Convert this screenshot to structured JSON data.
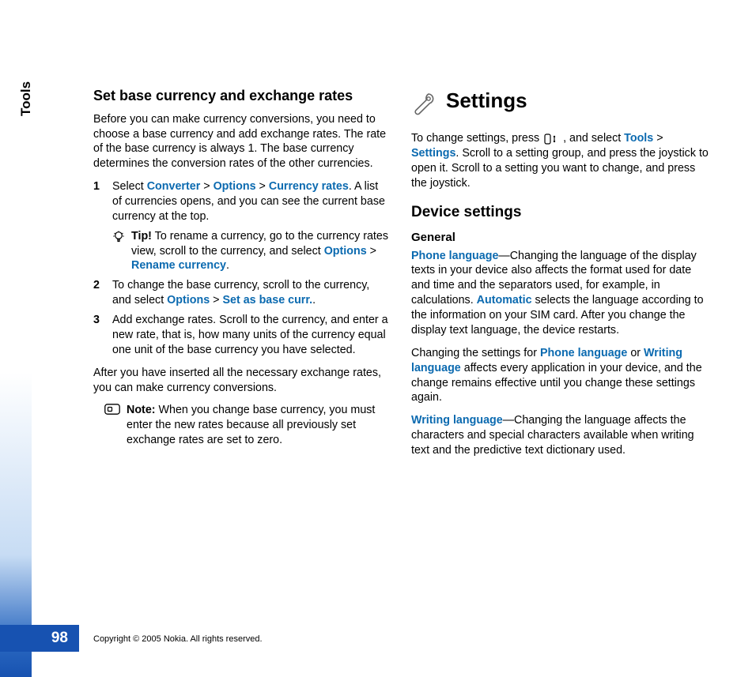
{
  "page_number": "98",
  "section_label": "Tools",
  "copyright": "Copyright © 2005 Nokia. All rights reserved.",
  "left": {
    "h1": "Set base currency and exchange rates",
    "p1": "Before you can make currency conversions, you need to choose a base currency and add exchange rates. The rate of the base currency is always 1. The base currency determines the conversion rates of the other currencies.",
    "li1_num": "1",
    "li1_a": "Select ",
    "li1_b": "Converter",
    "li1_c": " > ",
    "li1_d": "Options",
    "li1_e": " > ",
    "li1_f": "Currency rates",
    "li1_g": ". A list of currencies opens, and you can see the current base currency at the top.",
    "tip_label": "Tip!",
    "tip_a": " To rename a currency, go to the currency rates view, scroll to the currency, and select ",
    "tip_b": "Options",
    "tip_c": " > ",
    "tip_d": "Rename currency",
    "tip_e": ".",
    "li2_num": "2",
    "li2_a": "To change the base currency, scroll to the currency, and select ",
    "li2_b": "Options",
    "li2_c": " > ",
    "li2_d": "Set as base curr.",
    "li2_e": ".",
    "li3_num": "3",
    "li3_a": "Add exchange rates. Scroll to the currency, and enter a new rate, that is, how many units of the currency equal one unit of the base currency you have selected.",
    "p2": "After you have inserted all the necessary exchange rates, you can make currency conversions.",
    "note_label": "Note:",
    "note_a": " When you change base currency, you must enter the new rates because all previously set exchange rates are set to zero."
  },
  "right": {
    "h1": "Settings",
    "p1_a": "To change settings, press ",
    "p1_b": " , and select ",
    "p1_c": "Tools",
    "p1_d": " > ",
    "p1_e": "Settings",
    "p1_f": ". Scroll to a setting group, and press the joystick to open it. Scroll to a setting you want to change, and press the joystick.",
    "h2": "Device settings",
    "h3": "General",
    "p2_a": "Phone language",
    "p2_b": "—Changing the language of the display texts in your device also affects the format used for date and time and the separators used, for example, in calculations. ",
    "p2_c": "Automatic",
    "p2_d": " selects the language according to the information on your SIM card. After you change the display text language, the device restarts.",
    "p3_a": "Changing the settings for ",
    "p3_b": "Phone language",
    "p3_c": " or ",
    "p3_d": "Writing language",
    "p3_e": " affects every application in your device, and the change remains effective until you change these settings again.",
    "p4_a": "Writing language",
    "p4_b": "—Changing the language affects the characters and special characters available when writing text and the predictive text dictionary used."
  }
}
